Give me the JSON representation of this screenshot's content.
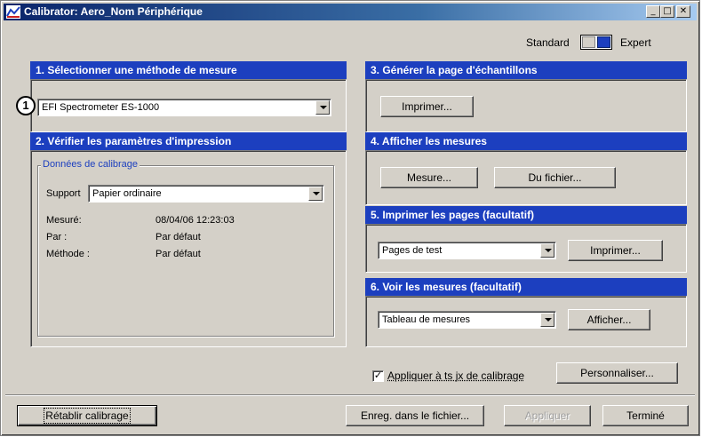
{
  "window": {
    "title": "Calibrator: Aero_Nom Périphérique",
    "minimize": "_",
    "maximize": "□",
    "close": "✕"
  },
  "mode": {
    "standard": "Standard",
    "expert": "Expert"
  },
  "step_badge": "1",
  "panel1": {
    "title": "1. Sélectionner une méthode de mesure",
    "method": "EFI Spectrometer ES-1000"
  },
  "panel2": {
    "title": "2. Vérifier les paramètres d'impression",
    "group": "Données de calibrage",
    "support_label": "Support",
    "support_value": "Papier ordinaire",
    "rows": [
      {
        "label": "Mesuré:",
        "value": "08/04/06  12:23:03"
      },
      {
        "label": "Par :",
        "value": "Par défaut"
      },
      {
        "label": "Méthode :",
        "value": "Par défaut"
      }
    ]
  },
  "panel3": {
    "title": "3. Générer la page d'échantillons",
    "print_button": "Imprimer..."
  },
  "panel4": {
    "title": "4. Afficher les mesures",
    "measure_button": "Mesure...",
    "from_file_button": "Du fichier..."
  },
  "panel5": {
    "title": "5. Imprimer les pages (facultatif)",
    "select": "Pages de test",
    "print_button": "Imprimer..."
  },
  "panel6": {
    "title": "6. Voir les mesures (facultatif)",
    "select": "Tableau de mesures",
    "show_button": "Afficher..."
  },
  "apply_all": {
    "checked": "✓",
    "label": "Appliquer à ts jx de calibrage",
    "customize_button": "Personnaliser..."
  },
  "footer": {
    "reset": "Rétablir calibrage",
    "save": "Enreg. dans le fichier...",
    "apply": "Appliquer",
    "done": "Terminé"
  },
  "colors": {
    "header_blue": "#1c3fbf",
    "face": "#d4d0c8"
  }
}
